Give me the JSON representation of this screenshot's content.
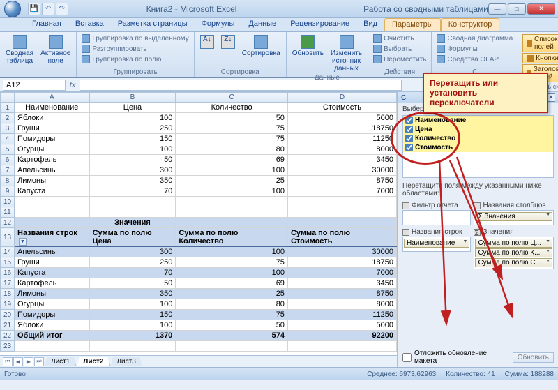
{
  "app": {
    "title": "Книга2 - Microsoft Excel",
    "context_title": "Работа со сводными таблицами"
  },
  "tabs": [
    "Главная",
    "Вставка",
    "Разметка страницы",
    "Формулы",
    "Данные",
    "Рецензирование",
    "Вид",
    "Параметры",
    "Конструктор"
  ],
  "ribbon": {
    "g1": {
      "b1": "Сводная\nтаблица",
      "b2": "Активное\nполе",
      "title": ""
    },
    "g2": {
      "i1": "Группировка по выделенному",
      "i2": "Разгруппировать",
      "i3": "Группировка по полю",
      "title": "Группировать"
    },
    "g3": {
      "b1": "Сортировка",
      "title": "Сортировка"
    },
    "g4": {
      "b1": "Обновить",
      "b2": "Изменить\nисточник данных",
      "title": "Данные"
    },
    "g5": {
      "i1": "Очистить",
      "i2": "Выбрать",
      "i3": "Переместить",
      "title": "Действия"
    },
    "g6": {
      "i1": "Сводная диаграмма",
      "i2": "Формулы",
      "i3": "Средства OLAP",
      "title": "С"
    },
    "right": {
      "b1": "Список полей",
      "b2": "Кнопки +/-",
      "b3": "Заголовки полей"
    },
    "hide": "ь скрыть"
  },
  "namebox": "A12",
  "columns": [
    "A",
    "B",
    "C",
    "D"
  ],
  "data_rows": [
    {
      "r": "1",
      "a": "Наименование",
      "b": "Цена",
      "c": "Количество",
      "d": "Стоимость",
      "hdr": true
    },
    {
      "r": "2",
      "a": "Яблоки",
      "b": "100",
      "c": "50",
      "d": "5000"
    },
    {
      "r": "3",
      "a": "Груши",
      "b": "250",
      "c": "75",
      "d": "18750"
    },
    {
      "r": "4",
      "a": "Помидоры",
      "b": "150",
      "c": "75",
      "d": "11250"
    },
    {
      "r": "5",
      "a": "Огурцы",
      "b": "100",
      "c": "80",
      "d": "8000"
    },
    {
      "r": "6",
      "a": "Картофель",
      "b": "50",
      "c": "69",
      "d": "3450"
    },
    {
      "r": "7",
      "a": "Апельсины",
      "b": "300",
      "c": "100",
      "d": "30000"
    },
    {
      "r": "8",
      "a": "Лимоны",
      "b": "350",
      "c": "25",
      "d": "8750"
    },
    {
      "r": "9",
      "a": "Капуста",
      "b": "70",
      "c": "100",
      "d": "7000"
    }
  ],
  "pivot": {
    "section": "Значения",
    "headers": [
      "Названия строк",
      "Сумма по полю Цена",
      "Сумма по полю Количество",
      "Сумма по полю Стоимость"
    ],
    "rows": [
      {
        "r": "14",
        "a": "Апельсины",
        "b": "300",
        "c": "100",
        "d": "30000"
      },
      {
        "r": "15",
        "a": "Груши",
        "b": "250",
        "c": "75",
        "d": "18750"
      },
      {
        "r": "16",
        "a": "Капуста",
        "b": "70",
        "c": "100",
        "d": "7000"
      },
      {
        "r": "17",
        "a": "Картофель",
        "b": "50",
        "c": "69",
        "d": "3450"
      },
      {
        "r": "18",
        "a": "Лимоны",
        "b": "350",
        "c": "25",
        "d": "8750"
      },
      {
        "r": "19",
        "a": "Огурцы",
        "b": "100",
        "c": "80",
        "d": "8000"
      },
      {
        "r": "20",
        "a": "Помидоры",
        "b": "150",
        "c": "75",
        "d": "11250"
      },
      {
        "r": "21",
        "a": "Яблоки",
        "b": "100",
        "c": "50",
        "d": "5000"
      }
    ],
    "total": {
      "r": "22",
      "a": "Общий итог",
      "b": "1370",
      "c": "574",
      "d": "92200"
    }
  },
  "sheets": [
    "Лист1",
    "Лист2",
    "Лист3"
  ],
  "taskpane": {
    "title": "С",
    "prompt": "Выберите поля для добавления в отчет:",
    "fields": [
      "Наименование",
      "Цена",
      "Количество",
      "Стоимость"
    ],
    "drag_label": "Перетащите поля между указанными ниже областями:",
    "areas": {
      "filter": "Фильтр отчета",
      "cols": "Названия столбцов",
      "rows": "Названия строк",
      "vals": "Значения",
      "cols_item": "Σ Значения",
      "rows_item": "Наименование",
      "vals_items": [
        "Сумма по полю Ц...",
        "Сумма по полю К...",
        "Сумма по полю С..."
      ]
    },
    "defer": "Отложить обновление макета",
    "update": "Обновить"
  },
  "status": {
    "ready": "Готово",
    "avg": "Среднее: 6973,62963",
    "count": "Количество: 41",
    "sum": "Сумма: 188288"
  },
  "callout": "Перетащить или установить переключатели"
}
